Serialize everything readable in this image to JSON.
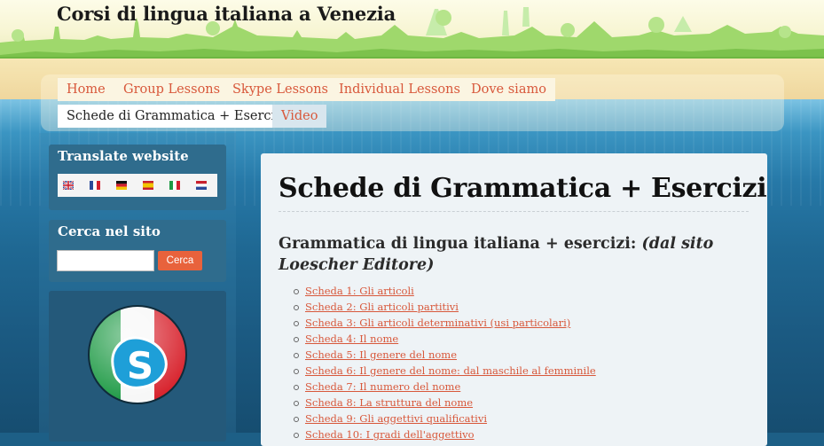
{
  "site": {
    "title": "Corsi di lingua italiana a Venezia"
  },
  "nav": {
    "items": [
      {
        "label": "Home"
      },
      {
        "label": "Group Lessons"
      },
      {
        "label": "Skype Lessons"
      },
      {
        "label": "Individual Lessons"
      },
      {
        "label": "Dove siamo"
      },
      {
        "label": "Schede di Grammatica + Esercizi",
        "active": true
      },
      {
        "label": "Video"
      }
    ]
  },
  "sidebar": {
    "translate": {
      "title": "Translate website",
      "flags": [
        "uk-flag-icon",
        "france-flag-icon",
        "germany-flag-icon",
        "spain-flag-icon",
        "italy-flag-icon",
        "netherlands-flag-icon"
      ]
    },
    "search": {
      "title": "Cerca nel sito",
      "button_label": "Cerca",
      "value": ""
    },
    "badge": {
      "icon": "skype-italy-badge-icon"
    }
  },
  "main": {
    "title": "Schede di Grammatica + Esercizi",
    "subhead": "Grammatica di lingua italiana + esercizi:",
    "subhead_em": "(dal sito Loescher Editore)",
    "links": [
      "Scheda 1: Gli articoli",
      "Scheda 2: Gli articoli partitivi",
      "Scheda 3: Gli articoli determinativi (usi particolari)",
      "Scheda 4: Il nome",
      "Scheda 5: Il genere del nome",
      "Scheda 6: Il genere del nome: dal maschile al femminile",
      "Scheda 7: Il numero del nome",
      "Scheda 8: La struttura del nome",
      "Scheda 9: Gli aggettivi qualificativi",
      "Scheda 10: I gradi dell'aggettivo"
    ]
  },
  "colors": {
    "link": "#d8583b",
    "button": "#e8623c",
    "sidebar": "#2f6c8d"
  }
}
